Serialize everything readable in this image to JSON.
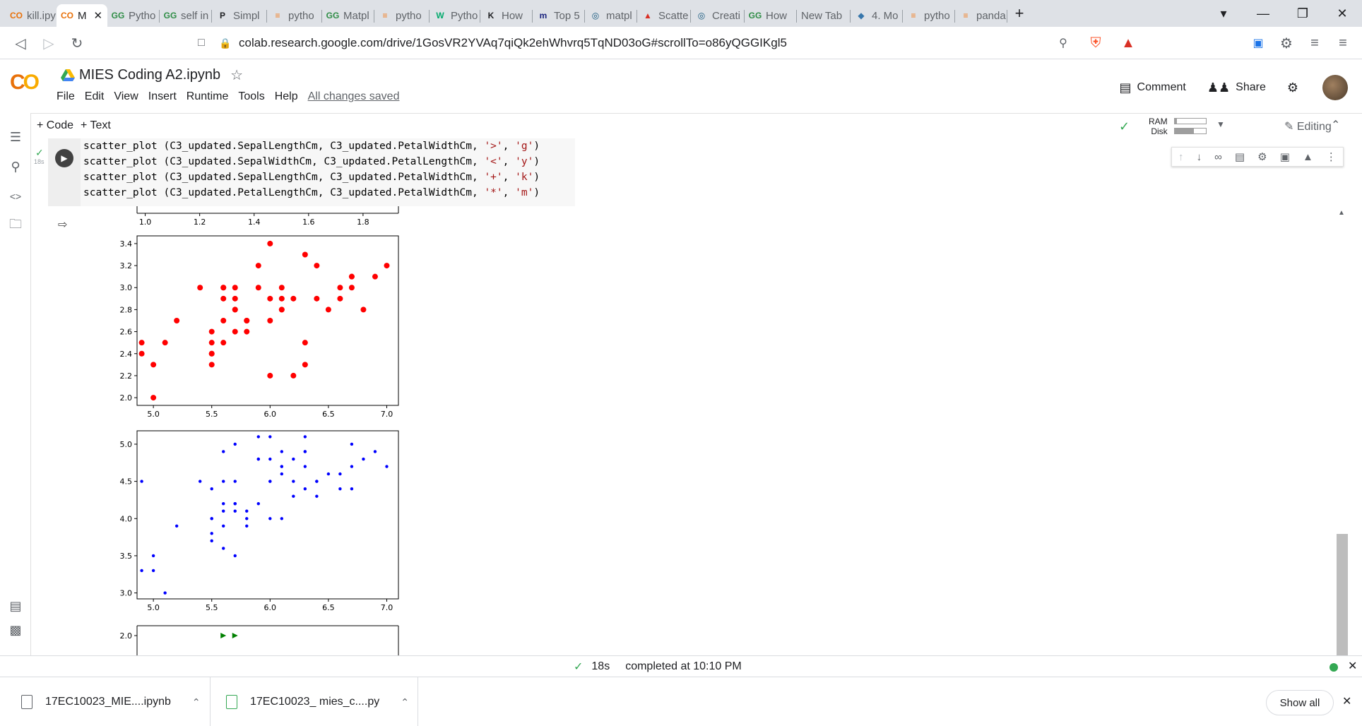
{
  "browser": {
    "tabs": [
      {
        "label": "kill.ipy",
        "icon": "colab-icon"
      },
      {
        "label": "M",
        "icon": "colab-icon",
        "active": true
      },
      {
        "label": "Pytho",
        "icon": "geeks-icon"
      },
      {
        "label": "self in",
        "icon": "geeks-icon"
      },
      {
        "label": "Simpl",
        "icon": "p-icon"
      },
      {
        "label": "pytho",
        "icon": "stackoverflow-icon"
      },
      {
        "label": "Matpl",
        "icon": "geeks-icon"
      },
      {
        "label": "pytho",
        "icon": "stackoverflow-icon"
      },
      {
        "label": "Pytho",
        "icon": "w3-icon"
      },
      {
        "label": "How",
        "icon": "k-icon"
      },
      {
        "label": "Top 5",
        "icon": "m-icon"
      },
      {
        "label": "matpl",
        "icon": "matplotlib-icon"
      },
      {
        "label": "Scatte",
        "icon": "a-icon"
      },
      {
        "label": "Creati",
        "icon": "matplotlib-icon"
      },
      {
        "label": "How",
        "icon": "geeks-icon"
      },
      {
        "label": "New Tab",
        "icon": ""
      },
      {
        "label": "4. Mo",
        "icon": "python-icon"
      },
      {
        "label": "pytho",
        "icon": "stackoverflow-icon"
      },
      {
        "label": "panda",
        "icon": "stackoverflow-icon"
      }
    ],
    "url": "colab.research.google.com/drive/1GosVR2YVAq7qiQk2ehWhvrq5TqND03oG#scrollTo=o86yQGGIKgl5",
    "brave_badge": "2",
    "alert_badge": "1"
  },
  "colab": {
    "logo": "CO",
    "title": "MIES Coding A2.ipynb",
    "menu": [
      "File",
      "Edit",
      "View",
      "Insert",
      "Runtime",
      "Tools",
      "Help"
    ],
    "saved_status": "All changes saved",
    "comment_label": "Comment",
    "share_label": "Share",
    "add_code_label": "+ Code",
    "add_text_label": "+ Text",
    "ram_label": "RAM",
    "disk_label": "Disk",
    "editing_label": "Editing"
  },
  "cell": {
    "exec_time": "18s",
    "code_lines": [
      {
        "pre": "scatter_plot (C3_updated.SepalLengthCm, C3_updated.PetalWidthCm, ",
        "s1": "'>'",
        "mid": ", ",
        "s2": "'g'",
        "post": ")"
      },
      {
        "pre": "scatter_plot (C3_updated.SepalWidthCm, C3_updated.PetalLengthCm, ",
        "s1": "'<'",
        "mid": ", ",
        "s2": "'y'",
        "post": ")"
      },
      {
        "pre": "scatter_plot (C3_updated.SepalLengthCm, C3_updated.PetalWidthCm, ",
        "s1": "'+'",
        "mid": ", ",
        "s2": "'k'",
        "post": ")"
      },
      {
        "pre": "scatter_plot (C3_updated.PetalLengthCm, C3_updated.PetalWidthCm, ",
        "s1": "'*'",
        "mid": ", ",
        "s2": "'m'",
        "post": ")"
      }
    ]
  },
  "status": {
    "time": "18s",
    "text": "completed at 10:10 PM"
  },
  "downloads": {
    "items": [
      "17EC10023_MIE....ipynb",
      "17EC10023_ mies_c....py"
    ],
    "show_all": "Show all"
  },
  "chart_data": [
    {
      "type": "scatter",
      "note": "partially visible plot (scrolled), only x ticks shown",
      "x_ticks": [
        "1.0",
        "1.2",
        "1.4",
        "1.6",
        "1.8"
      ],
      "xlim": [
        0.97,
        1.93
      ]
    },
    {
      "type": "scatter",
      "marker": "o",
      "color": "#ff0000",
      "xlim": [
        4.86,
        7.1
      ],
      "ylim": [
        1.93,
        3.47
      ],
      "x_ticks": [
        "5.0",
        "5.5",
        "6.0",
        "6.5",
        "7.0"
      ],
      "y_ticks": [
        "2.0",
        "2.2",
        "2.4",
        "2.6",
        "2.8",
        "3.0",
        "3.2",
        "3.4"
      ],
      "points": [
        [
          7.0,
          3.2
        ],
        [
          6.4,
          3.2
        ],
        [
          6.9,
          3.1
        ],
        [
          5.5,
          2.3
        ],
        [
          6.5,
          2.8
        ],
        [
          5.7,
          2.8
        ],
        [
          6.3,
          3.3
        ],
        [
          4.9,
          2.4
        ],
        [
          6.6,
          2.9
        ],
        [
          5.2,
          2.7
        ],
        [
          5.0,
          2.0
        ],
        [
          5.9,
          3.0
        ],
        [
          6.0,
          2.2
        ],
        [
          6.1,
          2.9
        ],
        [
          5.6,
          2.9
        ],
        [
          6.7,
          3.1
        ],
        [
          5.6,
          3.0
        ],
        [
          5.8,
          2.7
        ],
        [
          6.2,
          2.2
        ],
        [
          5.6,
          2.5
        ],
        [
          5.9,
          3.2
        ],
        [
          6.1,
          2.8
        ],
        [
          6.3,
          2.5
        ],
        [
          6.1,
          2.8
        ],
        [
          6.4,
          2.9
        ],
        [
          6.6,
          3.0
        ],
        [
          6.8,
          2.8
        ],
        [
          6.7,
          3.0
        ],
        [
          6.0,
          2.9
        ],
        [
          5.7,
          2.6
        ],
        [
          5.5,
          2.4
        ],
        [
          5.5,
          2.4
        ],
        [
          5.8,
          2.7
        ],
        [
          6.0,
          2.7
        ],
        [
          5.4,
          3.0
        ],
        [
          6.0,
          3.4
        ],
        [
          6.7,
          3.1
        ],
        [
          6.3,
          2.3
        ],
        [
          5.6,
          3.0
        ],
        [
          5.5,
          2.5
        ],
        [
          5.5,
          2.6
        ],
        [
          6.1,
          3.0
        ],
        [
          5.8,
          2.6
        ],
        [
          5.0,
          2.3
        ],
        [
          5.6,
          2.7
        ],
        [
          5.7,
          3.0
        ],
        [
          5.7,
          2.9
        ],
        [
          6.2,
          2.9
        ],
        [
          5.1,
          2.5
        ],
        [
          5.7,
          2.8
        ],
        [
          4.9,
          2.5
        ]
      ]
    },
    {
      "type": "scatter",
      "marker": ".",
      "color": "#0000ff",
      "xlim": [
        4.86,
        7.1
      ],
      "ylim": [
        2.92,
        5.18
      ],
      "x_ticks": [
        "5.0",
        "5.5",
        "6.0",
        "6.5",
        "7.0"
      ],
      "y_ticks": [
        "3.0",
        "3.5",
        "4.0",
        "4.5",
        "5.0"
      ],
      "points": [
        [
          7.0,
          4.7
        ],
        [
          6.4,
          4.5
        ],
        [
          6.9,
          4.9
        ],
        [
          5.5,
          4.0
        ],
        [
          6.5,
          4.6
        ],
        [
          5.7,
          4.5
        ],
        [
          6.3,
          4.7
        ],
        [
          4.9,
          3.3
        ],
        [
          6.6,
          4.6
        ],
        [
          5.2,
          3.9
        ],
        [
          5.0,
          3.5
        ],
        [
          5.9,
          4.2
        ],
        [
          6.0,
          4.0
        ],
        [
          6.1,
          4.7
        ],
        [
          5.6,
          3.6
        ],
        [
          6.7,
          4.4
        ],
        [
          5.6,
          4.5
        ],
        [
          5.8,
          4.1
        ],
        [
          6.2,
          4.5
        ],
        [
          5.6,
          3.9
        ],
        [
          5.9,
          4.8
        ],
        [
          6.1,
          4.0
        ],
        [
          6.3,
          4.9
        ],
        [
          6.1,
          4.7
        ],
        [
          6.4,
          4.3
        ],
        [
          6.6,
          4.4
        ],
        [
          6.8,
          4.8
        ],
        [
          6.7,
          5.0
        ],
        [
          6.0,
          4.5
        ],
        [
          5.7,
          3.5
        ],
        [
          5.5,
          3.8
        ],
        [
          5.5,
          3.7
        ],
        [
          5.8,
          3.9
        ],
        [
          6.0,
          5.1
        ],
        [
          5.4,
          4.5
        ],
        [
          6.0,
          4.5
        ],
        [
          6.7,
          4.7
        ],
        [
          6.3,
          4.4
        ],
        [
          5.6,
          4.1
        ],
        [
          5.5,
          4.0
        ],
        [
          5.5,
          4.4
        ],
        [
          6.1,
          4.6
        ],
        [
          5.8,
          4.0
        ],
        [
          5.0,
          3.3
        ],
        [
          5.6,
          4.2
        ],
        [
          5.7,
          4.2
        ],
        [
          5.7,
          4.2
        ],
        [
          6.2,
          4.3
        ],
        [
          5.1,
          3.0
        ],
        [
          5.7,
          4.1
        ],
        [
          4.9,
          4.5
        ],
        [
          5.9,
          5.1
        ],
        [
          6.0,
          4.8
        ],
        [
          6.3,
          5.1
        ],
        [
          5.6,
          4.9
        ],
        [
          5.7,
          5.0
        ],
        [
          6.2,
          4.8
        ],
        [
          6.3,
          4.9
        ],
        [
          6.1,
          4.9
        ],
        [
          6.4,
          4.5
        ],
        [
          5.9,
          4.8
        ]
      ]
    },
    {
      "type": "scatter",
      "marker": ">",
      "color": "#008000",
      "note": "mostly cut off by scroll; only top visible",
      "y_ticks": [
        "2.0"
      ],
      "xlim": [
        4.86,
        7.1
      ],
      "points": [
        [
          5.6,
          2.0
        ],
        [
          5.7,
          2.0
        ]
      ]
    }
  ]
}
